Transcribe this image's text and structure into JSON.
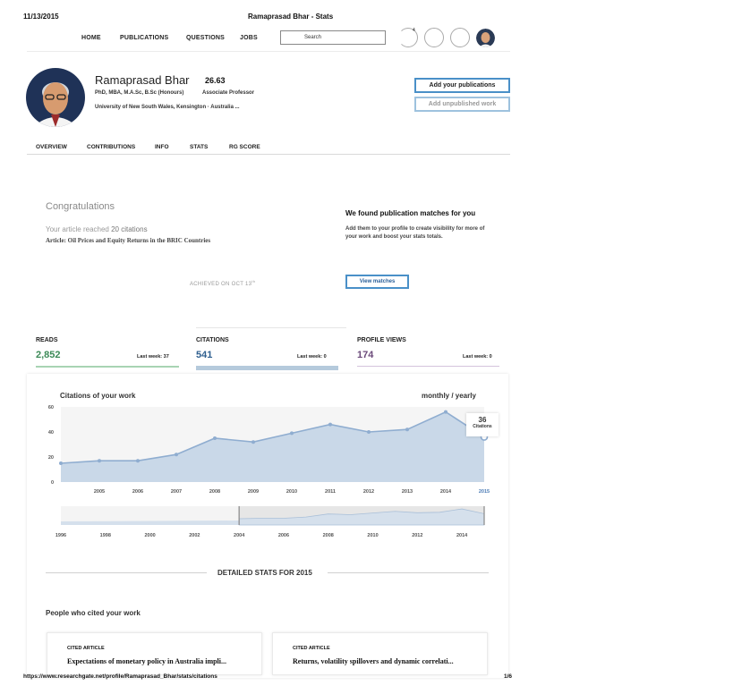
{
  "print_header": {
    "date": "11/13/2015",
    "title": "Ramaprasad Bhar - Stats"
  },
  "nav": {
    "items": [
      "HOME",
      "PUBLICATIONS",
      "QUESTIONS",
      "JOBS"
    ],
    "search_placeholder": "Search",
    "notification_count": "4"
  },
  "profile": {
    "name": "Ramaprasad Bhar",
    "score": "26.63",
    "degrees": "PhD, MBA, M.A.Sc, B.Sc (Honours)",
    "position": "Associate Professor",
    "affiliation": "University of New South Wales, Kensington · Australia ...",
    "add_publications_label": "Add your publications",
    "add_unpublished_label": "Add unpublished work"
  },
  "tabs": [
    "OVERVIEW",
    "CONTRIBUTIONS",
    "INFO",
    "STATS",
    "RG SCORE"
  ],
  "congrats": {
    "heading": "Congratulations",
    "line_prefix": "Your article reached",
    "line_value": "20 citations",
    "article": "Article: Oil Prices and Equity Returns in the BRIC Countries",
    "achieved": "ACHIEVED ON OCT 13",
    "achieved_sup": "th"
  },
  "matches": {
    "heading": "We found publication matches for you",
    "description": "Add them to your profile to create visibility for more of your work and boost your stats totals.",
    "button_label": "View matches"
  },
  "stats": [
    {
      "label": "READS",
      "value": "2,852",
      "week": "Last week: 37",
      "color": "#3c8a57",
      "line": "#a8d4b3"
    },
    {
      "label": "CITATIONS",
      "value": "541",
      "week": "Last week: 0",
      "color": "#2f5f8f",
      "line": "#b5cadc"
    },
    {
      "label": "PROFILE VIEWS",
      "value": "174",
      "week": "Last week: 0",
      "color": "#6b4a7a",
      "line": "#d4c4dc"
    }
  ],
  "chart": {
    "title": "Citations of your work",
    "period_toggle": "monthly / yearly",
    "tooltip_value": "36",
    "tooltip_label": "Citations",
    "fill_color": "#c9d8e8",
    "line_color": "#8fadd0"
  },
  "chart_data": {
    "type": "area",
    "x": [
      "2004",
      "2005",
      "2006",
      "2007",
      "2008",
      "2009",
      "2010",
      "2011",
      "2012",
      "2013",
      "2014",
      "2015"
    ],
    "values": [
      15,
      17,
      17,
      22,
      35,
      32,
      39,
      46,
      40,
      42,
      56,
      36
    ],
    "y_ticks": [
      "0",
      "20",
      "40",
      "60"
    ],
    "ylim": [
      0,
      60
    ],
    "x_tick_labels": [
      "2005",
      "2006",
      "2007",
      "2008",
      "2009",
      "2010",
      "2011",
      "2012",
      "2013",
      "2014",
      "2015"
    ],
    "highlight": "2015",
    "navigator_ticks": [
      "1996",
      "1998",
      "2000",
      "2002",
      "2004",
      "2006",
      "2008",
      "2010",
      "2012",
      "2014"
    ],
    "navigator_range": [
      "2004",
      "2015"
    ]
  },
  "detailed": {
    "heading": "DETAILED STATS FOR 2015",
    "people_heading": "People who cited your work",
    "cards": [
      {
        "tag": "CITED ARTICLE",
        "title": "Expectations of monetary policy in Australia impli..."
      },
      {
        "tag": "CITED ARTICLE",
        "title": "Returns, volatility spillovers and dynamic correlati..."
      }
    ]
  },
  "print_footer": {
    "url": "https://www.researchgate.net/profile/Ramaprasad_Bhar/stats/citations",
    "page": "1/6"
  }
}
